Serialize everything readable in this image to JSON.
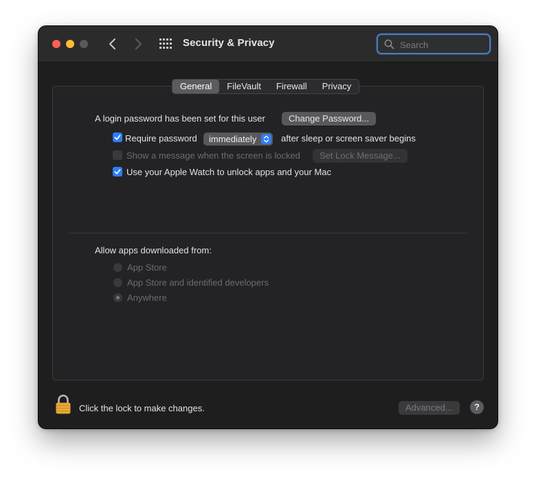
{
  "window": {
    "title": "Security & Privacy",
    "search_placeholder": "Search"
  },
  "tabs": [
    {
      "label": "General",
      "active": true
    },
    {
      "label": "FileVault",
      "active": false
    },
    {
      "label": "Firewall",
      "active": false
    },
    {
      "label": "Privacy",
      "active": false
    }
  ],
  "general": {
    "login_text": "A login password has been set for this user",
    "change_password_label": "Change Password...",
    "require_password": {
      "label": "Require password",
      "checked": true
    },
    "require_popup_value": "immediately",
    "after_text": "after sleep or screen saver begins",
    "show_message": {
      "label": "Show a message when the screen is locked",
      "checked": false,
      "enabled": false
    },
    "set_lock_message_label": "Set Lock Message...",
    "apple_watch": {
      "label": "Use your Apple Watch to unlock apps and your Mac",
      "checked": true
    }
  },
  "allow_apps": {
    "heading": "Allow apps downloaded from:",
    "options": [
      {
        "label": "App Store",
        "selected": false
      },
      {
        "label": "App Store and identified developers",
        "selected": false
      },
      {
        "label": "Anywhere",
        "selected": true
      }
    ]
  },
  "footer": {
    "lock_text": "Click the lock to make changes.",
    "advanced_label": "Advanced...",
    "help_label": "?"
  },
  "colors": {
    "accent": "#2f7df6",
    "close": "#fe5f57",
    "minimize": "#febc2e",
    "window_bg": "#1e1e1f",
    "lock": "#e6a935"
  }
}
